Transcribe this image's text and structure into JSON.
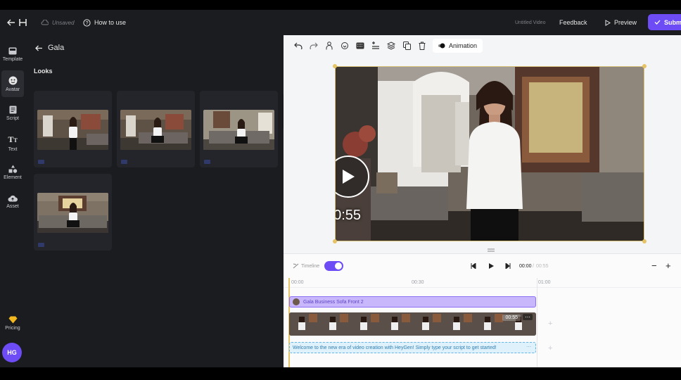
{
  "topbar": {
    "save_status": "Unsaved",
    "how_to_use": "How to use",
    "video_title": "Untitled Video",
    "feedback": "Feedback",
    "preview": "Preview",
    "submit": "Submit"
  },
  "rail": {
    "items": [
      {
        "label": "Template",
        "icon": "template-icon"
      },
      {
        "label": "Avatar",
        "icon": "avatar-icon"
      },
      {
        "label": "Script",
        "icon": "script-icon"
      },
      {
        "label": "Text",
        "icon": "text-icon"
      },
      {
        "label": "Element",
        "icon": "element-icon"
      },
      {
        "label": "Asset",
        "icon": "asset-icon"
      }
    ],
    "pricing": "Pricing",
    "user_initials": "HG"
  },
  "panel": {
    "title": "Gala",
    "section": "Looks",
    "cards": [
      {
        "badge": "4K"
      },
      {
        "badge": "4K"
      },
      {
        "badge": "4K"
      },
      {
        "badge": "4K"
      }
    ]
  },
  "toolbar": {
    "animation": "Animation"
  },
  "canvas": {
    "time": "00:55"
  },
  "timeline": {
    "label": "Timeline",
    "current_time": "00:00",
    "total_time": "00:55",
    "ruler": {
      "start": "00:00",
      "mid": "00:30",
      "end": "01:00"
    },
    "avatar_track": "Gala Business Sofa Front 2",
    "video_duration": "00:55",
    "script_track": "Welcome to the new era of video creation with HeyGen! Simply type your script to get started!"
  },
  "colors": {
    "accent": "#6d4cf6",
    "selection": "#e6c364",
    "panel_bg": "#1b1c1f"
  }
}
